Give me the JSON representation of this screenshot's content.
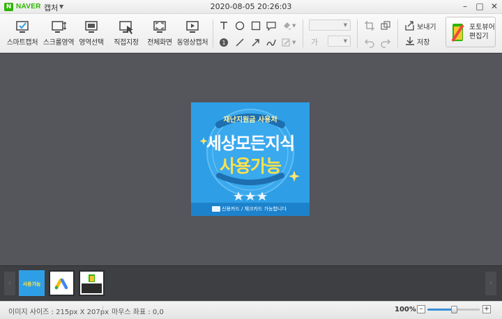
{
  "titlebar": {
    "logo_letter": "N",
    "app_name": "NAVER",
    "app_sub": "캡처",
    "datetime": "2020-08-05 20:26:03",
    "minimize": "–",
    "maximize": "□",
    "close": "✕"
  },
  "toolbar": {
    "tools": [
      {
        "label": "스마트캡처",
        "icon": "smart-capture-icon"
      },
      {
        "label": "스크롤영역",
        "icon": "scroll-area-icon"
      },
      {
        "label": "영역선택",
        "icon": "area-select-icon"
      },
      {
        "label": "직접지정",
        "icon": "manual-select-icon"
      },
      {
        "label": "전체화면",
        "icon": "fullscreen-icon"
      },
      {
        "label": "동영상캡처",
        "icon": "video-capture-icon"
      }
    ],
    "font_size_label": "가",
    "export_label": "보내기",
    "save_label": "저장",
    "photo_editor_label_1": "포토뷰어",
    "photo_editor_label_2": "편집기"
  },
  "preview": {
    "badge": "재난지원금 사용처",
    "line1": "세상모든지식",
    "line2": "사용가능",
    "footer": "신용카드 / 체크카드 가능합니다"
  },
  "filmstrip": {
    "thumb1_label": "사용가능",
    "prev": "‹",
    "next": "›"
  },
  "status": {
    "image_size_label": "이미지 사이즈 : 215px X 207px",
    "mouse_coord_label": "마우스 좌표 : 0,0",
    "zoom": "100%",
    "zoom_out": "–",
    "zoom_in": "+",
    "zoom_level": 0.5
  },
  "colors": {
    "accent": "#2e9fe6",
    "naver_green": "#2db400",
    "canvas": "#54565b"
  }
}
